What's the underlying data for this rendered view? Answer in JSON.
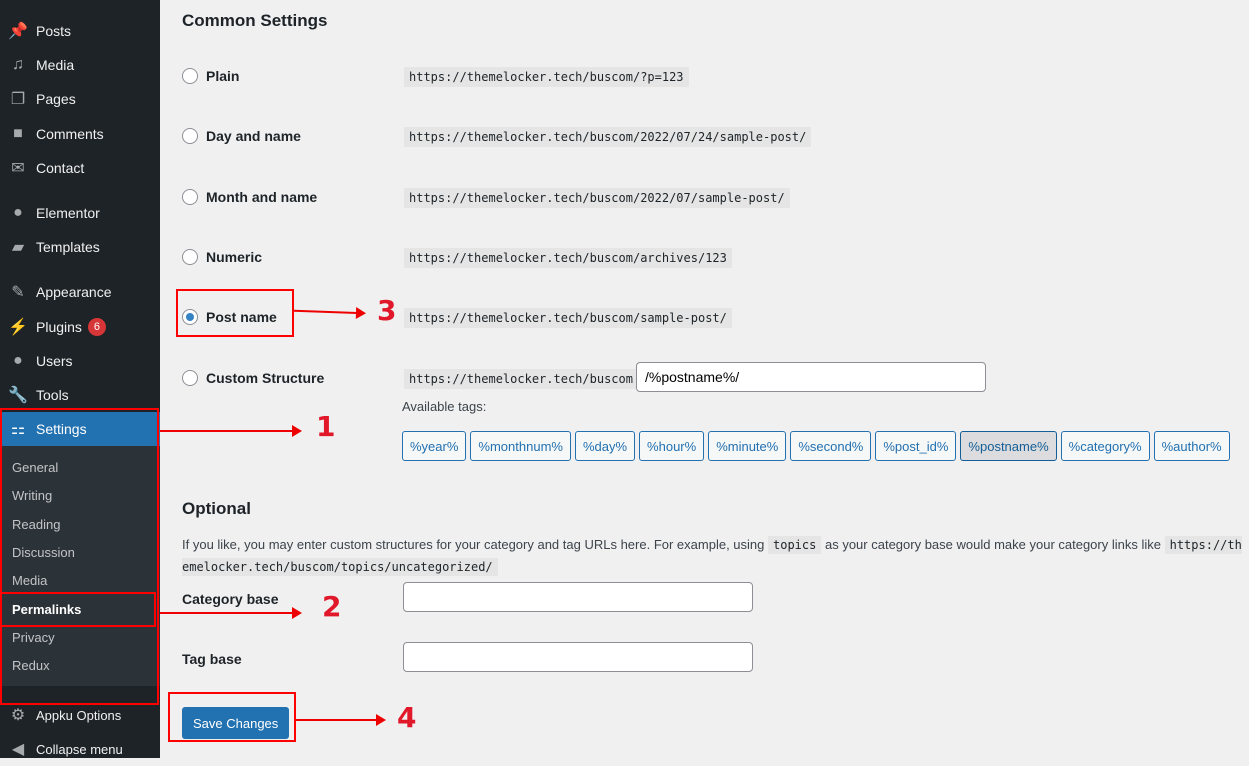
{
  "sidebar": {
    "items": [
      {
        "label": "Posts",
        "icon": "pin-icon",
        "glyph": "📌"
      },
      {
        "label": "Media",
        "icon": "media-icon",
        "glyph": "♫"
      },
      {
        "label": "Pages",
        "icon": "pages-icon",
        "glyph": "❐"
      },
      {
        "label": "Comments",
        "icon": "comment-icon",
        "glyph": "■"
      },
      {
        "label": "Contact",
        "icon": "mail-icon",
        "glyph": "✉"
      },
      {
        "label": "Elementor",
        "icon": "elementor-icon",
        "glyph": "●"
      },
      {
        "label": "Templates",
        "icon": "folder-icon",
        "glyph": "▰"
      },
      {
        "label": "Appearance",
        "icon": "brush-icon",
        "glyph": "✎"
      },
      {
        "label": "Plugins",
        "icon": "plug-icon",
        "glyph": "⚡",
        "badge": "6"
      },
      {
        "label": "Users",
        "icon": "user-icon",
        "glyph": "●"
      },
      {
        "label": "Tools",
        "icon": "wrench-icon",
        "glyph": "🔧"
      },
      {
        "label": "Settings",
        "icon": "settings-icon",
        "glyph": "⚏"
      },
      {
        "label": "Appku Options",
        "icon": "gear-icon",
        "glyph": "⚙"
      },
      {
        "label": "Collapse menu",
        "icon": "collapse-icon",
        "glyph": "◀"
      }
    ],
    "submenu": [
      "General",
      "Writing",
      "Reading",
      "Discussion",
      "Media",
      "Permalinks",
      "Privacy",
      "Redux"
    ]
  },
  "annotations": [
    "1",
    "2",
    "3",
    "4"
  ],
  "common": {
    "title": "Common Settings",
    "options": [
      {
        "label": "Plain",
        "url": "https://themelocker.tech/buscom/?p=123"
      },
      {
        "label": "Day and name",
        "url": "https://themelocker.tech/buscom/2022/07/24/sample-post/"
      },
      {
        "label": "Month and name",
        "url": "https://themelocker.tech/buscom/2022/07/sample-post/"
      },
      {
        "label": "Numeric",
        "url": "https://themelocker.tech/buscom/archives/123"
      },
      {
        "label": "Post name",
        "url": "https://themelocker.tech/buscom/sample-post/",
        "selected": true
      },
      {
        "label": "Custom Structure",
        "url": "https://themelocker.tech/buscom"
      }
    ],
    "custom_value": "/%postname%/",
    "available_tags_label": "Available tags:",
    "tags": [
      "%year%",
      "%monthnum%",
      "%day%",
      "%hour%",
      "%minute%",
      "%second%",
      "%post_id%",
      "%postname%",
      "%category%",
      "%author%"
    ],
    "active_tag": "%postname%"
  },
  "optional": {
    "title": "Optional",
    "desc_pre": "If you like, you may enter custom structures for your category and tag URLs here. For example, using",
    "desc_code": "topics",
    "desc_post": "as your category base would make your category links like",
    "desc_code2": "https://themelocker.tech/buscom/topics/uncategorized/",
    "category_label": "Category base",
    "category_value": "",
    "tag_label": "Tag base",
    "tag_value": ""
  },
  "save_label": "Save Changes"
}
